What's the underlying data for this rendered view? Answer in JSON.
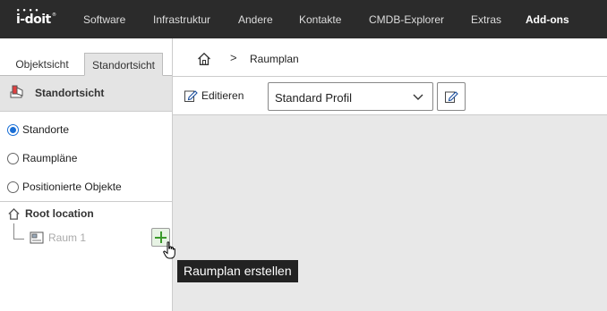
{
  "app": {
    "logo_text": "i-doit"
  },
  "nav": {
    "items": [
      {
        "label": "Software"
      },
      {
        "label": "Infrastruktur"
      },
      {
        "label": "Andere"
      },
      {
        "label": "Kontakte"
      },
      {
        "label": "CMDB-Explorer"
      },
      {
        "label": "Extras"
      },
      {
        "label": "Add-ons",
        "active": true
      }
    ]
  },
  "left_panel": {
    "tabs": [
      {
        "label": "Objektsicht"
      },
      {
        "label": "Standortsicht",
        "active": true
      }
    ],
    "section_title": "Standortsicht",
    "view_options": [
      {
        "label": "Standorte",
        "checked": true
      },
      {
        "label": "Raumpläne",
        "checked": false
      },
      {
        "label": "Positionierte Objekte",
        "checked": false
      }
    ],
    "tree": {
      "root_label": "Root location",
      "child_label": "Raum 1"
    }
  },
  "breadcrumb": {
    "home_icon": "home-icon",
    "separator": ">",
    "current": "Raumplan"
  },
  "toolbar": {
    "edit_label": "Editieren",
    "profile_select_value": "Standard Profil"
  },
  "tooltip": {
    "text": "Raumplan erstellen"
  },
  "colors": {
    "topbar": "#2b2b2b",
    "accent_radio": "#1a6fd6",
    "plus_green": "#3a9a2a",
    "canvas_bg": "#e8e8e8"
  }
}
